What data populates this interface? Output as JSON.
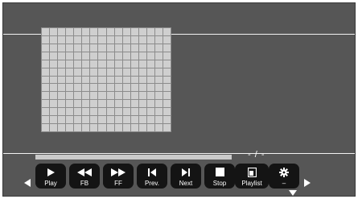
{
  "player": {
    "time_display": "- / -",
    "progress_fraction": 0
  },
  "image": {
    "grid_columns": 16,
    "grid_rows": 13
  },
  "controls": [
    {
      "id": "play",
      "label": "Play",
      "icon": "play-icon"
    },
    {
      "id": "fb",
      "label": "FB",
      "icon": "fast-backward-icon"
    },
    {
      "id": "ff",
      "label": "FF",
      "icon": "fast-forward-icon"
    },
    {
      "id": "prev",
      "label": "Prev.",
      "icon": "previous-icon"
    },
    {
      "id": "next",
      "label": "Next",
      "icon": "next-icon"
    },
    {
      "id": "stop",
      "label": "Stop",
      "icon": "stop-icon"
    },
    {
      "id": "playlist",
      "label": "Playlist",
      "icon": "playlist-icon"
    },
    {
      "id": "settings",
      "label": "–",
      "icon": "gear-icon"
    }
  ],
  "navigation": {
    "left": "arrow-left-icon",
    "right": "arrow-right-icon",
    "down": "arrow-down-icon"
  }
}
